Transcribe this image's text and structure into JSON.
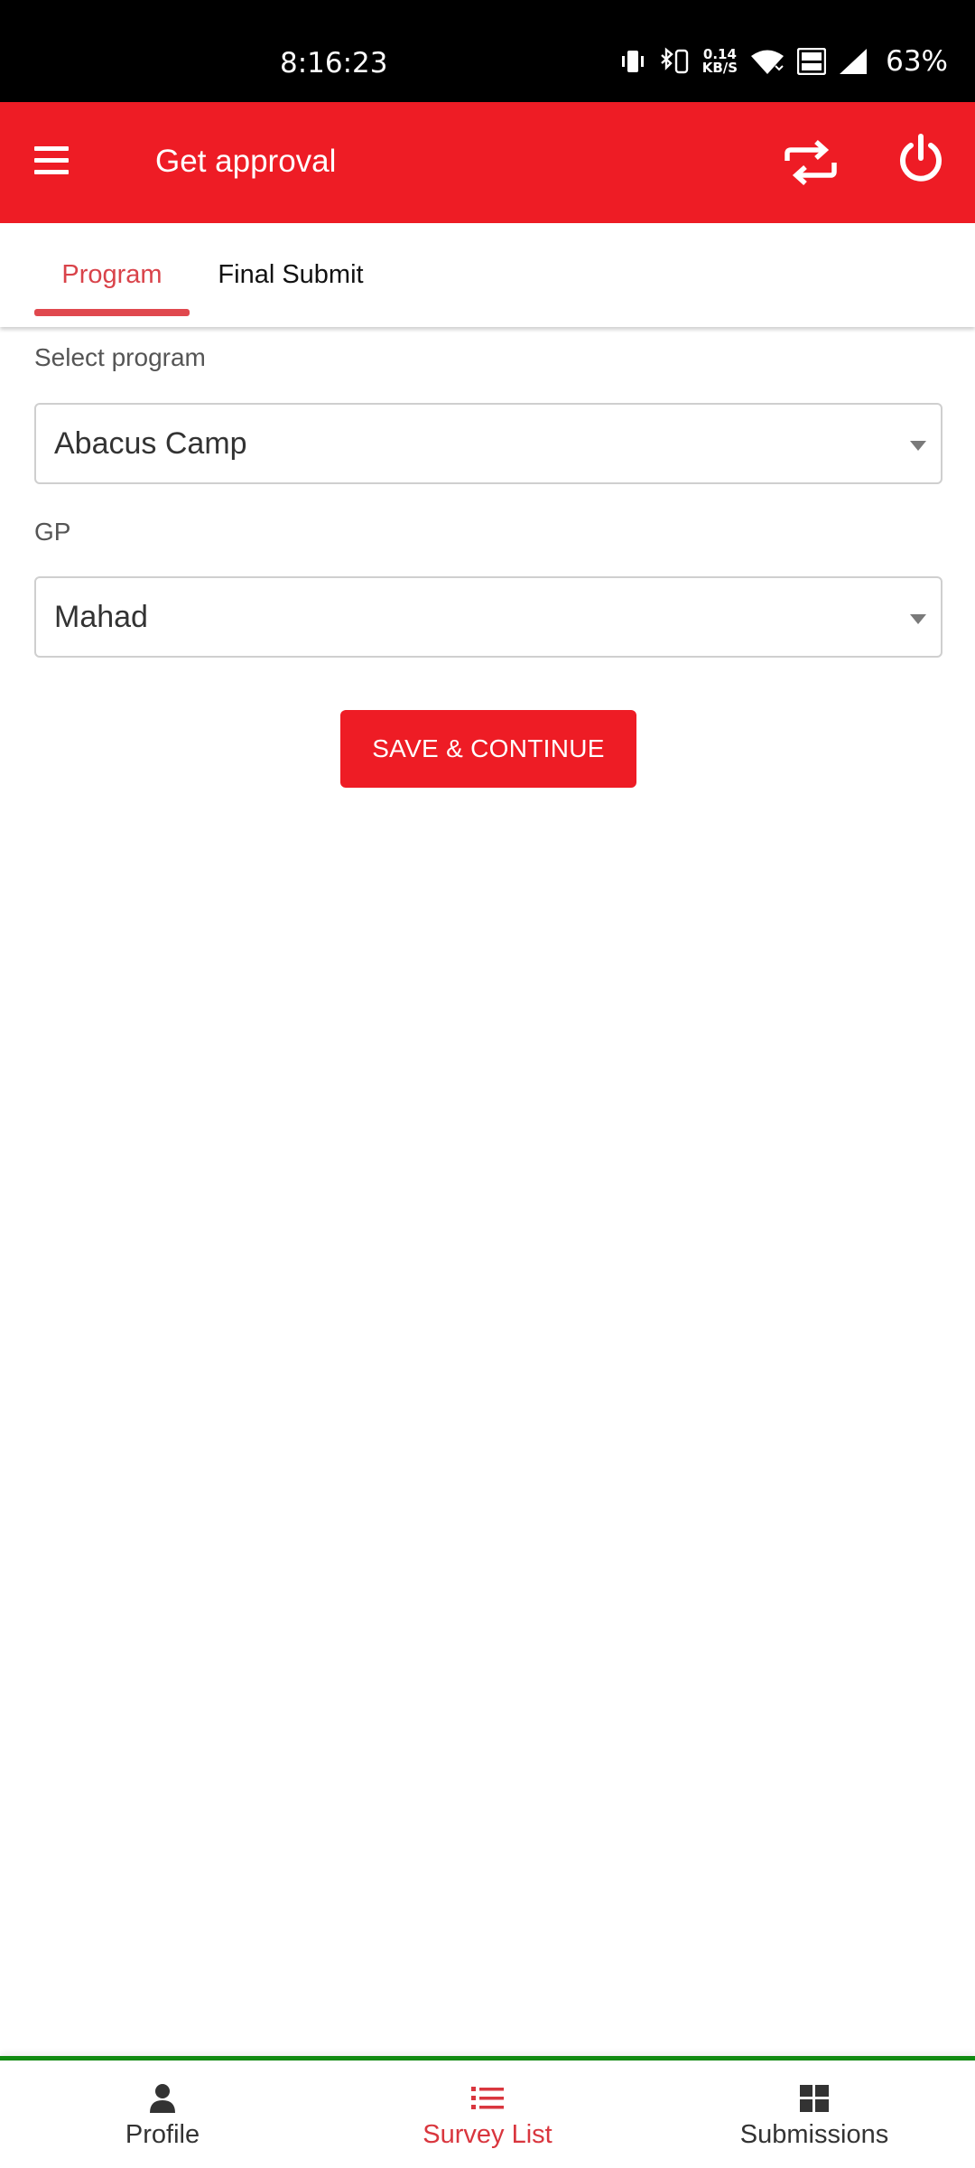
{
  "status_bar": {
    "time": "8:16:23",
    "net_speed_value": "0.14",
    "net_speed_unit": "KB/S",
    "battery": "63%",
    "icons": [
      "vibrate-icon",
      "bluetooth-icon",
      "wifi-icon",
      "volte-icon",
      "signal-icon"
    ]
  },
  "app_bar": {
    "title": "Get approval",
    "icons": [
      "menu-icon",
      "sync-icon",
      "power-icon"
    ],
    "color": "#ee1c25"
  },
  "tabs": [
    {
      "label": "Program",
      "active": true
    },
    {
      "label": "Final Submit",
      "active": false
    }
  ],
  "form": {
    "program_label": "Select program",
    "program_value": "Abacus Camp",
    "gp_label": "GP",
    "gp_value": "Mahad",
    "save_label": "SAVE & CONTINUE"
  },
  "bottom_nav": {
    "items": [
      {
        "label": "Profile",
        "icon": "person-icon",
        "active": false
      },
      {
        "label": "Survey List",
        "icon": "list-icon",
        "active": true
      },
      {
        "label": "Submissions",
        "icon": "grid-icon",
        "active": false
      }
    ],
    "active_color": "#d9363e",
    "border_color": "#108a10"
  }
}
